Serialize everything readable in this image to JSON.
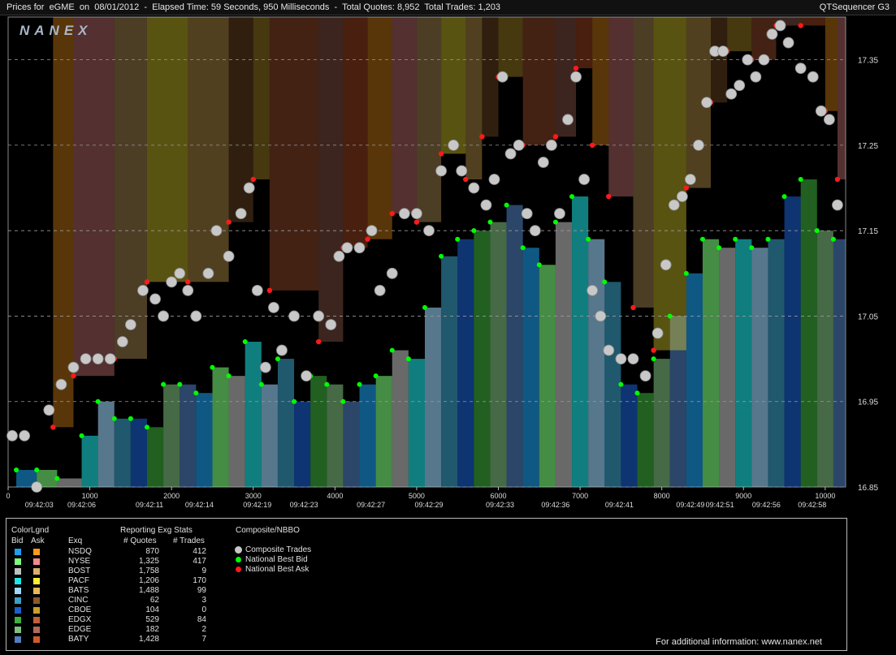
{
  "header": {
    "title": "Prices for  eGME  on  08/01/2012  -  Elapsed Time: 59 Seconds, 950 Milliseconds  -  Total Quotes: 8,952  Total Trades: 1,203",
    "app": "QTSequencer G3"
  },
  "logo": "NANEX",
  "chart_data": {
    "type": "scatter",
    "y_ticks": [
      "17.35",
      "17.25",
      "17.15",
      "17.05",
      "16.95",
      "16.85"
    ],
    "y_tick_values": [
      17.35,
      17.25,
      17.15,
      17.05,
      16.95,
      16.85
    ],
    "ylim": [
      16.85,
      17.4
    ],
    "x_ticks": [
      "0",
      "1000",
      "2000",
      "3000",
      "4000",
      "5000",
      "6000",
      "7000",
      "8000",
      "9000",
      "10000"
    ],
    "x_tick_values": [
      0,
      1000,
      2000,
      3000,
      4000,
      5000,
      6000,
      7000,
      8000,
      9000,
      10000
    ],
    "xlim": [
      0,
      10250
    ],
    "time_labels": [
      {
        "x": 380,
        "label": "09:42:03"
      },
      {
        "x": 900,
        "label": "09:42:06"
      },
      {
        "x": 1730,
        "label": "09:42:11"
      },
      {
        "x": 2340,
        "label": "09:42:14"
      },
      {
        "x": 3050,
        "label": "09:42:19"
      },
      {
        "x": 3620,
        "label": "09:42:23"
      },
      {
        "x": 4440,
        "label": "09:42:27"
      },
      {
        "x": 5150,
        "label": "09:42:29"
      },
      {
        "x": 6020,
        "label": "09:42:33"
      },
      {
        "x": 6700,
        "label": "09:42:36"
      },
      {
        "x": 7480,
        "label": "09:42:41"
      },
      {
        "x": 8350,
        "label": "09:42:49"
      },
      {
        "x": 8710,
        "label": "09:42:51"
      },
      {
        "x": 9280,
        "label": "09:42:56"
      },
      {
        "x": 9840,
        "label": "09:42:58"
      }
    ],
    "grid": true,
    "series": [
      {
        "name": "Composite Trades",
        "color": "#c8c8c8",
        "points": [
          [
            50,
            16.91
          ],
          [
            200,
            16.91
          ],
          [
            350,
            16.85
          ],
          [
            500,
            16.94
          ],
          [
            650,
            16.97
          ],
          [
            800,
            16.99
          ],
          [
            950,
            17.0
          ],
          [
            1100,
            17.0
          ],
          [
            1250,
            17.0
          ],
          [
            1400,
            17.02
          ],
          [
            1500,
            17.04
          ],
          [
            1650,
            17.08
          ],
          [
            1800,
            17.07
          ],
          [
            1900,
            17.05
          ],
          [
            2000,
            17.09
          ],
          [
            2100,
            17.1
          ],
          [
            2200,
            17.08
          ],
          [
            2300,
            17.05
          ],
          [
            2450,
            17.1
          ],
          [
            2550,
            17.15
          ],
          [
            2700,
            17.12
          ],
          [
            2850,
            17.17
          ],
          [
            2950,
            17.2
          ],
          [
            3050,
            17.08
          ],
          [
            3150,
            16.99
          ],
          [
            3250,
            17.06
          ],
          [
            3350,
            17.01
          ],
          [
            3500,
            17.05
          ],
          [
            3650,
            16.98
          ],
          [
            3800,
            17.05
          ],
          [
            3950,
            17.04
          ],
          [
            4050,
            17.12
          ],
          [
            4150,
            17.13
          ],
          [
            4300,
            17.13
          ],
          [
            4450,
            17.15
          ],
          [
            4550,
            17.08
          ],
          [
            4700,
            17.1
          ],
          [
            4850,
            17.17
          ],
          [
            5000,
            17.17
          ],
          [
            5150,
            17.15
          ],
          [
            5300,
            17.22
          ],
          [
            5450,
            17.25
          ],
          [
            5550,
            17.22
          ],
          [
            5700,
            17.2
          ],
          [
            5850,
            17.18
          ],
          [
            5950,
            17.21
          ],
          [
            6050,
            17.33
          ],
          [
            6150,
            17.24
          ],
          [
            6250,
            17.25
          ],
          [
            6350,
            17.17
          ],
          [
            6450,
            17.15
          ],
          [
            6550,
            17.23
          ],
          [
            6650,
            17.25
          ],
          [
            6750,
            17.17
          ],
          [
            6850,
            17.28
          ],
          [
            6950,
            17.33
          ],
          [
            7050,
            17.21
          ],
          [
            7150,
            17.08
          ],
          [
            7250,
            17.05
          ],
          [
            7350,
            17.01
          ],
          [
            7500,
            17.0
          ],
          [
            7650,
            17.0
          ],
          [
            7800,
            16.98
          ],
          [
            7950,
            17.03
          ],
          [
            8050,
            17.11
          ],
          [
            8150,
            17.18
          ],
          [
            8250,
            17.19
          ],
          [
            8350,
            17.21
          ],
          [
            8450,
            17.25
          ],
          [
            8550,
            17.3
          ],
          [
            8650,
            17.36
          ],
          [
            8750,
            17.36
          ],
          [
            8850,
            17.31
          ],
          [
            8950,
            17.32
          ],
          [
            9050,
            17.35
          ],
          [
            9150,
            17.33
          ],
          [
            9250,
            17.35
          ],
          [
            9350,
            17.38
          ],
          [
            9450,
            17.39
          ],
          [
            9550,
            17.37
          ],
          [
            9700,
            17.34
          ],
          [
            9850,
            17.33
          ],
          [
            9950,
            17.29
          ],
          [
            10050,
            17.28
          ],
          [
            10150,
            17.18
          ]
        ]
      },
      {
        "name": "National Best Bid",
        "color": "#00ff00",
        "points": [
          [
            100,
            16.87
          ],
          [
            350,
            16.87
          ],
          [
            600,
            16.86
          ],
          [
            900,
            16.91
          ],
          [
            1100,
            16.95
          ],
          [
            1300,
            16.93
          ],
          [
            1500,
            16.93
          ],
          [
            1700,
            16.92
          ],
          [
            1900,
            16.97
          ],
          [
            2100,
            16.97
          ],
          [
            2300,
            16.96
          ],
          [
            2500,
            16.99
          ],
          [
            2700,
            16.98
          ],
          [
            2900,
            17.02
          ],
          [
            3100,
            16.97
          ],
          [
            3300,
            17.0
          ],
          [
            3500,
            16.95
          ],
          [
            3700,
            16.98
          ],
          [
            3900,
            16.97
          ],
          [
            4100,
            16.95
          ],
          [
            4300,
            16.97
          ],
          [
            4500,
            16.98
          ],
          [
            4700,
            17.01
          ],
          [
            4900,
            17.0
          ],
          [
            5100,
            17.06
          ],
          [
            5300,
            17.12
          ],
          [
            5500,
            17.14
          ],
          [
            5700,
            17.15
          ],
          [
            5900,
            17.16
          ],
          [
            6100,
            17.18
          ],
          [
            6300,
            17.13
          ],
          [
            6500,
            17.11
          ],
          [
            6700,
            17.16
          ],
          [
            6900,
            17.19
          ],
          [
            7100,
            17.14
          ],
          [
            7300,
            17.09
          ],
          [
            7500,
            16.97
          ],
          [
            7700,
            16.96
          ],
          [
            7900,
            17.0
          ],
          [
            8100,
            17.05
          ],
          [
            8300,
            17.1
          ],
          [
            8500,
            17.14
          ],
          [
            8700,
            17.13
          ],
          [
            8900,
            17.14
          ],
          [
            9100,
            17.13
          ],
          [
            9300,
            17.14
          ],
          [
            9500,
            17.19
          ],
          [
            9700,
            17.21
          ],
          [
            9900,
            17.15
          ],
          [
            10100,
            17.14
          ]
        ]
      },
      {
        "name": "National Best Ask",
        "color": "#ff1a1a",
        "points": [
          [
            550,
            16.92
          ],
          [
            800,
            16.98
          ],
          [
            1300,
            17.0
          ],
          [
            1700,
            17.09
          ],
          [
            2200,
            17.09
          ],
          [
            2700,
            17.16
          ],
          [
            3000,
            17.21
          ],
          [
            3200,
            17.08
          ],
          [
            3800,
            17.02
          ],
          [
            4100,
            17.13
          ],
          [
            4400,
            17.14
          ],
          [
            4700,
            17.17
          ],
          [
            5000,
            17.16
          ],
          [
            5300,
            17.24
          ],
          [
            5600,
            17.21
          ],
          [
            5800,
            17.26
          ],
          [
            6000,
            17.33
          ],
          [
            6300,
            17.25
          ],
          [
            6700,
            17.26
          ],
          [
            6950,
            17.34
          ],
          [
            7150,
            17.25
          ],
          [
            7350,
            17.19
          ],
          [
            7650,
            17.06
          ],
          [
            7900,
            17.01
          ],
          [
            8300,
            17.2
          ],
          [
            8600,
            17.3
          ],
          [
            8800,
            17.36
          ],
          [
            9100,
            17.35
          ],
          [
            9400,
            17.39
          ],
          [
            9700,
            17.39
          ],
          [
            10000,
            17.29
          ],
          [
            10150,
            17.21
          ]
        ]
      }
    ]
  },
  "legend": {
    "colorlgnd_label": "ColorLgnd",
    "bid_label": "Bid",
    "ask_label": "Ask",
    "exq_label": "Exq",
    "stats_title": "Reporting Exg Stats",
    "quotes_label": "# Quotes",
    "trades_label": "# Trades",
    "composite_title": "Composite/NBBO",
    "rows": [
      {
        "ex": "NSDQ",
        "quotes": "870",
        "trades": "412",
        "bid": "#1ea0f0",
        "ask": "#ff9a1a"
      },
      {
        "ex": "NYSE",
        "quotes": "1,325",
        "trades": "417",
        "bid": "#7dff7d",
        "ask": "#f28a8a"
      },
      {
        "ex": "BOST",
        "quotes": "1,758",
        "trades": "9",
        "bid": "#bfbfbf",
        "ask": "#d9b06a"
      },
      {
        "ex": "PACF",
        "quotes": "1,206",
        "trades": "170",
        "bid": "#1ee6e6",
        "ask": "#ffee33"
      },
      {
        "ex": "BATS",
        "quotes": "1,488",
        "trades": "99",
        "bid": "#9ed8ff",
        "ask": "#e8b858"
      },
      {
        "ex": "CINC",
        "quotes": "62",
        "trades": "3",
        "bid": "#3aa0c8",
        "ask": "#8a5a2a"
      },
      {
        "ex": "CBOE",
        "quotes": "104",
        "trades": "0",
        "bid": "#1a5fd0",
        "ask": "#c8a02a"
      },
      {
        "ex": "EDGX",
        "quotes": "529",
        "trades": "84",
        "bid": "#3caf3c",
        "ask": "#c0603a"
      },
      {
        "ex": "EDGE",
        "quotes": "182",
        "trades": "2",
        "bid": "#7fbf7f",
        "ask": "#b06a5a"
      },
      {
        "ex": "BATY",
        "quotes": "1,428",
        "trades": "7",
        "bid": "#4f7fbf",
        "ask": "#d05a2a"
      }
    ],
    "composite_items": [
      {
        "label": "Composite Trades",
        "color": "#c8c8c8"
      },
      {
        "label": "National Best Bid",
        "color": "#00ff00"
      },
      {
        "label": "National Best Ask",
        "color": "#ff1a1a"
      }
    ]
  },
  "footer": "For additional information: www.nanex.net"
}
